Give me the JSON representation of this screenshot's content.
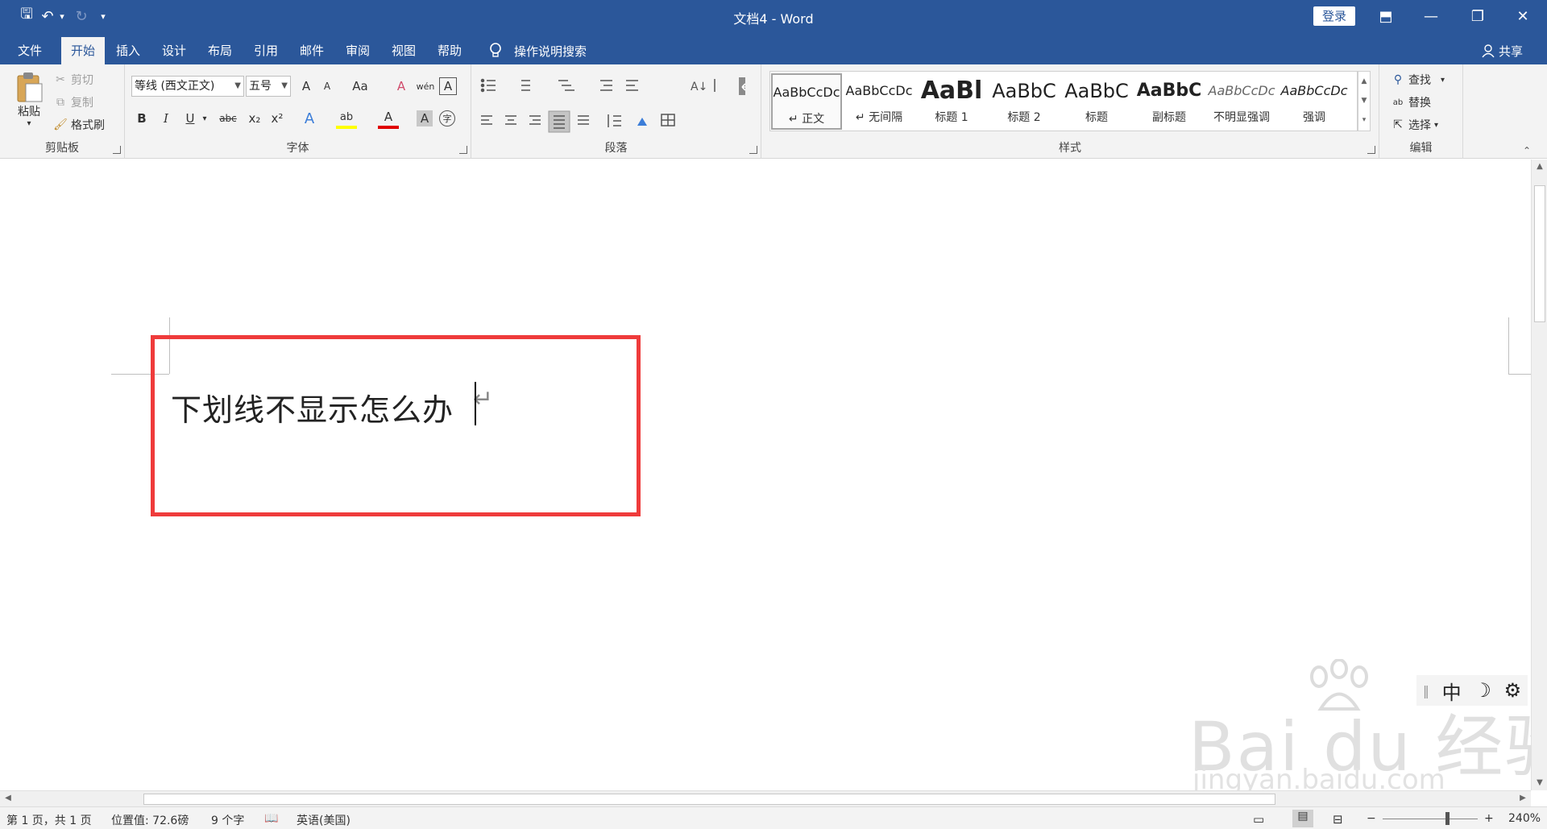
{
  "titlebar": {
    "title": "文档4 - Word",
    "login": "登录",
    "qat": {
      "save": "🖫",
      "undo": "↶",
      "undo_dd": "▾",
      "redo": "↻",
      "customize": "▾"
    },
    "win": {
      "ribbon_opts": "⬒",
      "minimize": "—",
      "restore": "❐",
      "close": "✕"
    }
  },
  "tabs": [
    "文件",
    "开始",
    "插入",
    "设计",
    "布局",
    "引用",
    "邮件",
    "审阅",
    "视图",
    "帮助"
  ],
  "active_tab": "开始",
  "tell_me": "操作说明搜索",
  "share": "共享",
  "ribbon": {
    "clipboard": {
      "label": "剪贴板",
      "paste": "粘贴",
      "cut": "剪切",
      "copy": "复制",
      "format_painter": "格式刷"
    },
    "font": {
      "label": "字体",
      "font_name": "等线 (西文正文)",
      "font_size": "五号",
      "grow": "A",
      "shrink": "A",
      "case": "Aa",
      "clear": "A",
      "phonetic": "wén",
      "border": "A",
      "bold": "B",
      "italic": "I",
      "underline": "U",
      "strike": "abc",
      "sub": "x₂",
      "sup": "x²",
      "effects": "A",
      "highlight": "ab",
      "font_color": "A",
      "shading": "A",
      "enclose": "字"
    },
    "paragraph": {
      "label": "段落"
    },
    "styles": {
      "label": "样式",
      "items": [
        {
          "preview": "AaBbCcDc",
          "name": "↵ 正文"
        },
        {
          "preview": "AaBbCcDc",
          "name": "↵ 无间隔"
        },
        {
          "preview": "AaBl",
          "name": "标题 1"
        },
        {
          "preview": "AaBbC",
          "name": "标题 2"
        },
        {
          "preview": "AaBbC",
          "name": "标题"
        },
        {
          "preview": "AaBbC",
          "name": "副标题"
        },
        {
          "preview": "AaBbCcDc",
          "name": "不明显强调"
        },
        {
          "preview": "AaBbCcDc",
          "name": "强调"
        }
      ]
    },
    "editing": {
      "label": "编辑",
      "find": "查找",
      "replace": "替换",
      "select": "选择"
    }
  },
  "document": {
    "text": "下划线不显示怎么办",
    "para_mark": "↵"
  },
  "ime": {
    "mode": "中",
    "moon": "☽",
    "settings": "⚙"
  },
  "watermark": {
    "main": "Bai du 经验",
    "sub": "jingyan.baidu.com"
  },
  "status": {
    "page": "第 1 页，共 1 页",
    "position": "位置值: 72.6磅",
    "words": "9 个字",
    "language": "英语(美国)",
    "zoom": "240%"
  }
}
